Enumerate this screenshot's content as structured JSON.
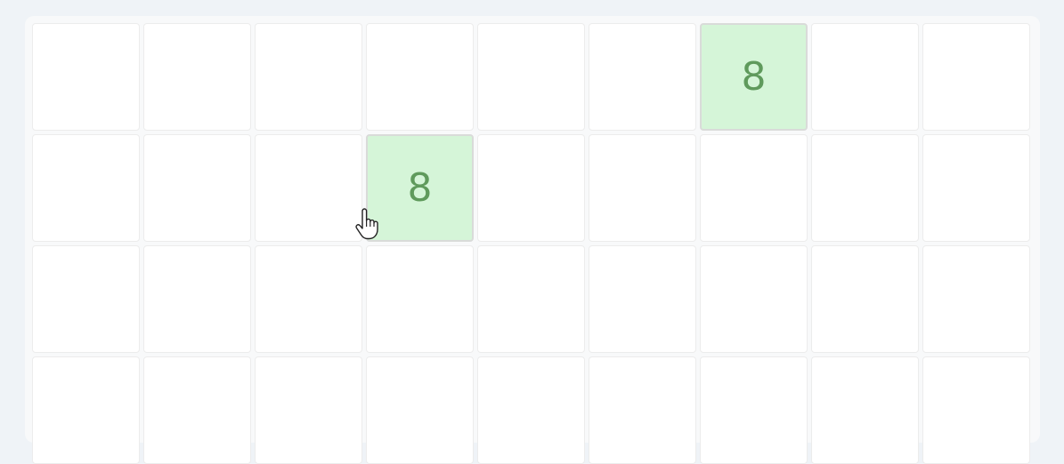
{
  "board": {
    "rows": 4,
    "cols": 9,
    "cells": [
      [
        "",
        "",
        "",
        "",
        "",
        "",
        "8",
        "",
        ""
      ],
      [
        "",
        "",
        "",
        "8",
        "",
        "",
        "",
        "",
        ""
      ],
      [
        "",
        "",
        "",
        "",
        "",
        "",
        "",
        "",
        ""
      ],
      [
        "",
        "",
        "",
        "",
        "",
        "",
        "",
        "",
        ""
      ]
    ]
  },
  "colors": {
    "revealed_bg": "#d5f5d8",
    "number_color": "#5f9a5c",
    "cell_bg": "#ffffff",
    "page_bg": "#eff3f7"
  },
  "cursor": {
    "icon": "hand-pointer-icon"
  }
}
